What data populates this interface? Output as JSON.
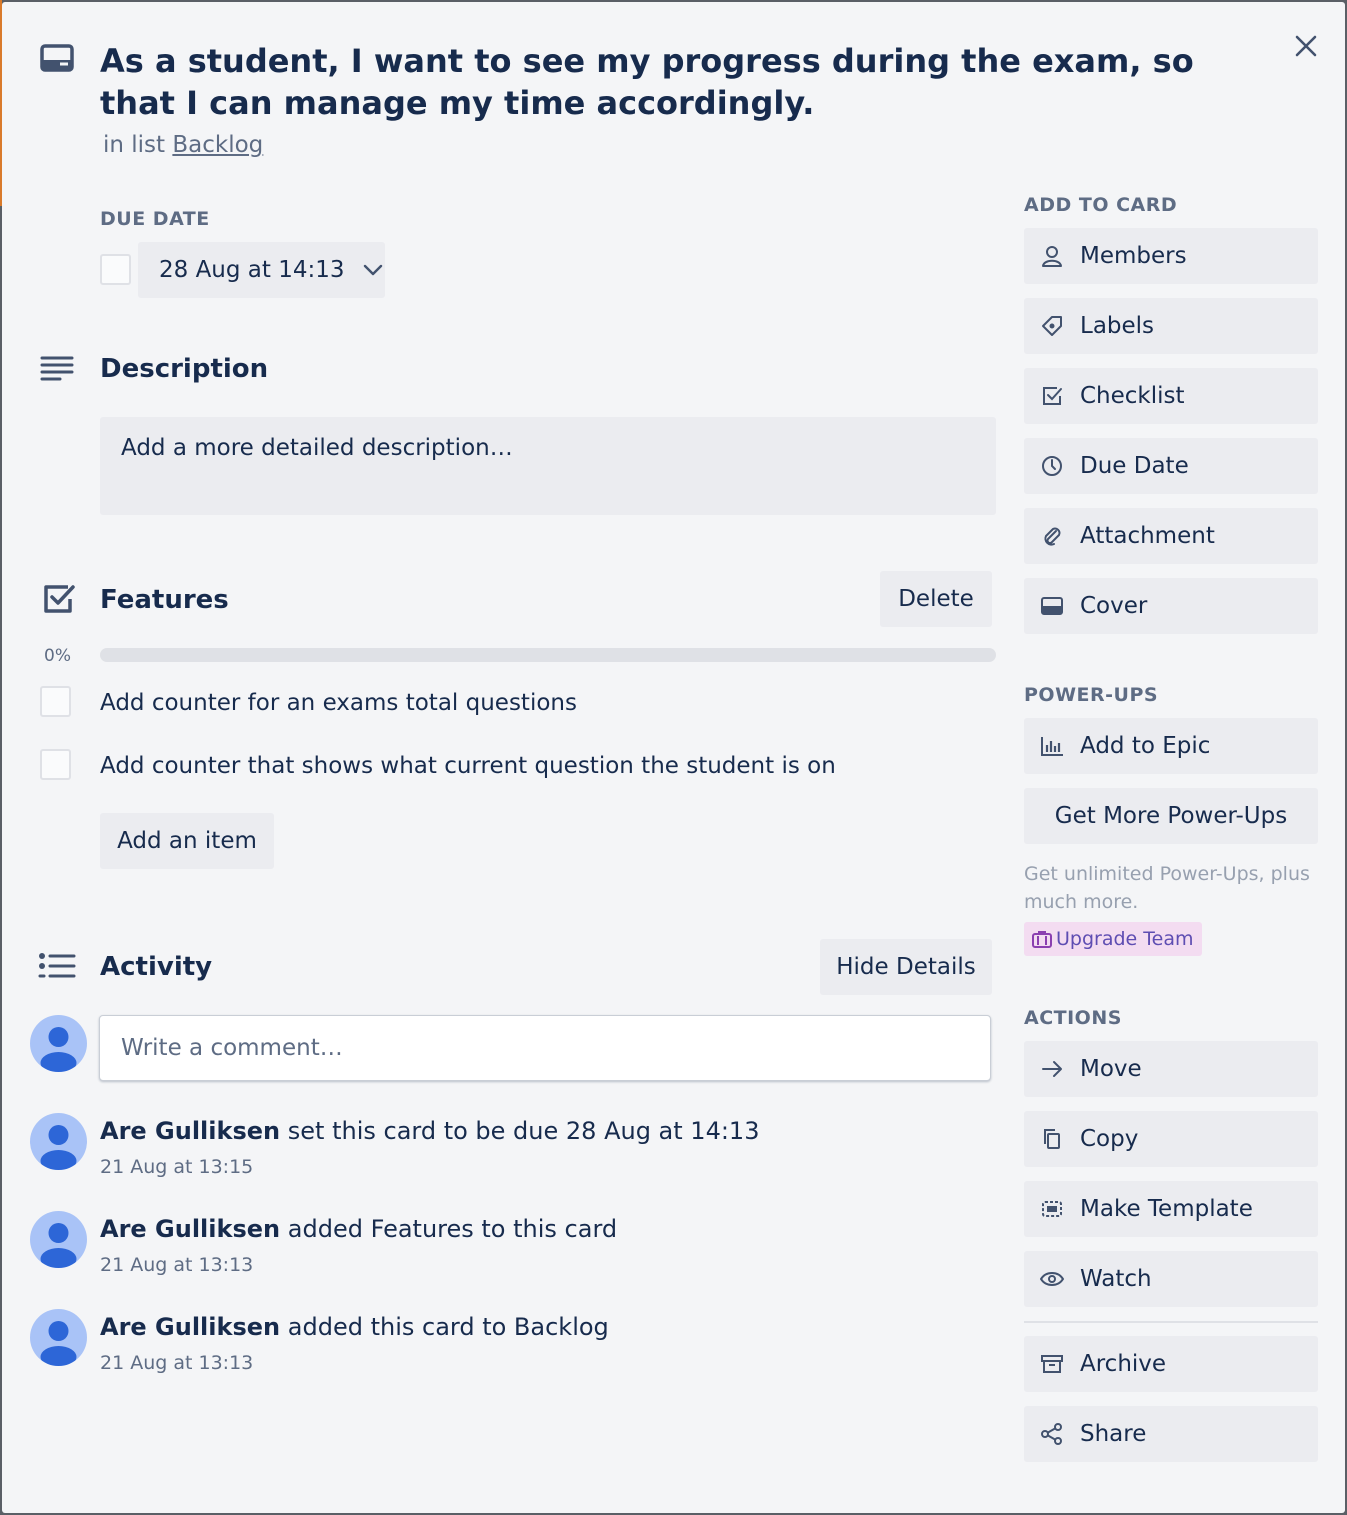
{
  "card": {
    "title": "As a student, I want to see my progress during the exam, so that I can manage my time accordingly.",
    "in_list_prefix": "in list",
    "list_name": "Backlog"
  },
  "due_date": {
    "label": "DUE DATE",
    "value": "28 Aug at 14:13"
  },
  "description": {
    "heading": "Description",
    "placeholder": "Add a more detailed description…"
  },
  "checklist": {
    "heading": "Features",
    "delete_label": "Delete",
    "progress_text": "0%",
    "progress": 0,
    "items": [
      "Add counter for an exams total questions",
      "Add counter that shows what current question the student is on"
    ],
    "add_item_label": "Add an item"
  },
  "activity": {
    "heading": "Activity",
    "hide_details_label": "Hide Details",
    "comment_placeholder": "Write a comment…",
    "entries": [
      {
        "user": "Are Gulliksen",
        "text": "set this card to be due 28 Aug at 14:13",
        "time": "21 Aug at 13:15"
      },
      {
        "user": "Are Gulliksen",
        "text": "added Features to this card",
        "time": "21 Aug at 13:13"
      },
      {
        "user": "Are Gulliksen",
        "text": "added this card to Backlog",
        "time": "21 Aug at 13:13"
      }
    ]
  },
  "sidebar": {
    "add_to_card_label": "ADD TO CARD",
    "add_to_card": [
      "Members",
      "Labels",
      "Checklist",
      "Due Date",
      "Attachment",
      "Cover"
    ],
    "powerups_label": "POWER-UPS",
    "add_to_epic": "Add to Epic",
    "get_more_powerups": "Get More Power-Ups",
    "upsell_text": "Get unlimited Power-Ups, plus much more.",
    "upgrade_label": "Upgrade Team",
    "actions_label": "ACTIONS",
    "actions": [
      "Move",
      "Copy",
      "Make Template",
      "Watch"
    ],
    "actions_bottom": [
      "Archive",
      "Share"
    ]
  },
  "colors": {
    "accent_progress": "#5aac44",
    "text": "#172b4d",
    "muted": "#5e6c84",
    "upgrade_bg": "#f3dcf1"
  }
}
